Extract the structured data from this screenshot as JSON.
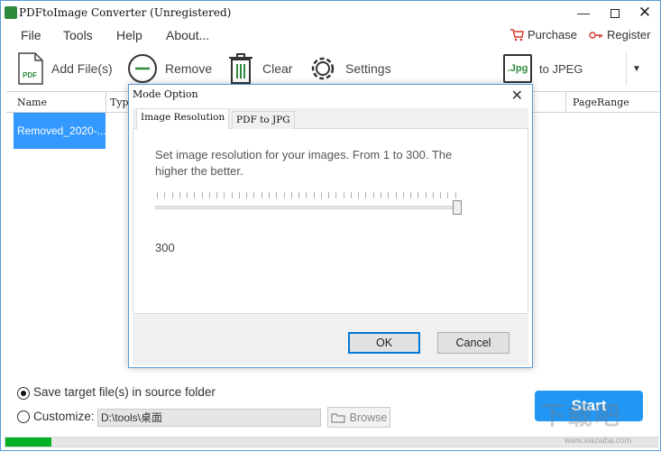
{
  "window": {
    "title": "PDFtoImage Converter (Unregistered)"
  },
  "menu": {
    "items": [
      "File",
      "Tools",
      "Help",
      "About..."
    ],
    "purchase": "Purchase",
    "register": "Register"
  },
  "toolbar": {
    "add_files": "Add File(s)",
    "remove": "Remove",
    "clear": "Clear",
    "settings": "Settings",
    "format_badge": ".Jpg",
    "format_label": "to JPEG"
  },
  "table": {
    "columns": [
      "Name",
      "Typ",
      "PageRange"
    ],
    "rows": [
      {
        "name": "Removed_2020-..."
      }
    ]
  },
  "bottom": {
    "option_source": "Save target file(s) in source folder",
    "option_customize": "Customize:",
    "path_value": "D:\\tools\\桌面",
    "browse_label": "Browse",
    "start_label": "Start",
    "progress": 0.07
  },
  "dialog": {
    "title": "Mode Option",
    "tabs": [
      "Image Resolution",
      "PDF to JPG"
    ],
    "description": "Set image resolution for your images. From 1 to 300.  The higher the better.",
    "resolution": {
      "value": "300",
      "min": 1,
      "max": 300,
      "level": 300
    },
    "ok_label": "OK",
    "cancel_label": "Cancel"
  },
  "watermark": {
    "text": "下载吧",
    "sub": "www.xiazaiba.com"
  },
  "colors": {
    "accent": "#2196f3",
    "selection": "#3399ff",
    "progress": "#06b025",
    "border": "#5a9bd5"
  }
}
